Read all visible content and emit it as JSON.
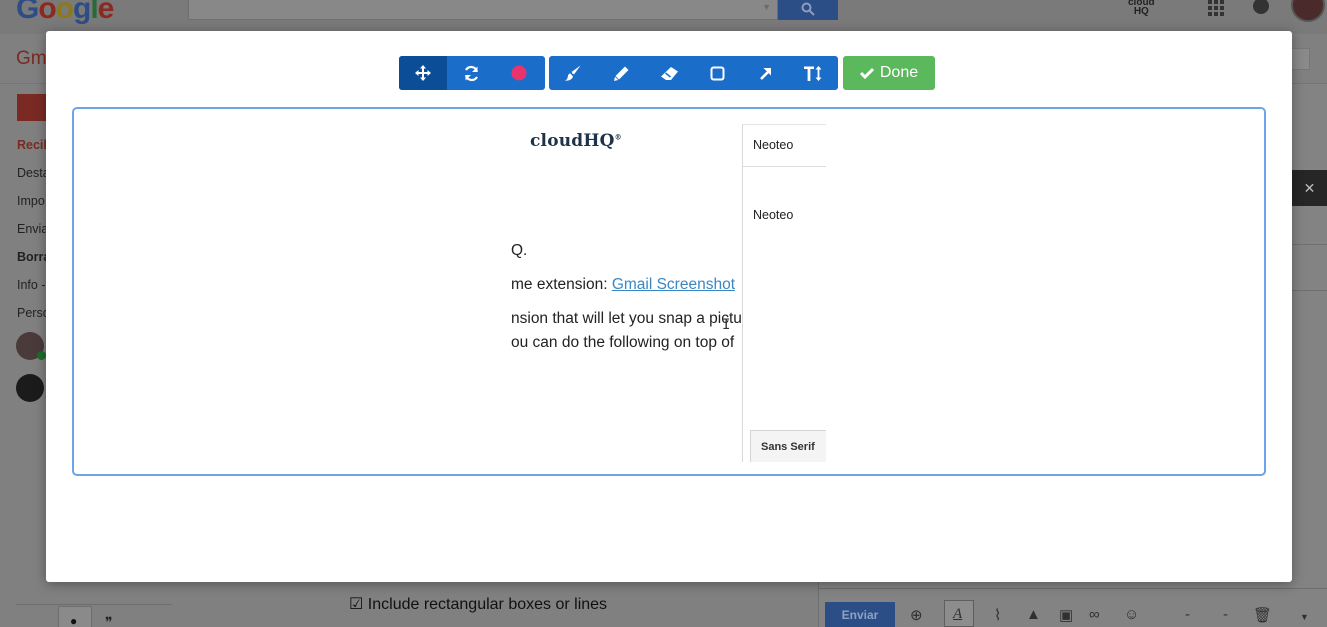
{
  "background": {
    "logo_text": "Google",
    "gmail_label": "Gm",
    "cloudhq_text_line1": "cloud",
    "cloudhq_text_line2": "HQ",
    "nav_items": [
      {
        "label": "Recil",
        "style": "active"
      },
      {
        "label": "Desta",
        "style": "normal"
      },
      {
        "label": "Impo",
        "style": "normal"
      },
      {
        "label": "Envia",
        "style": "normal"
      },
      {
        "label": "Borra",
        "style": "bold"
      },
      {
        "label": "Info -",
        "style": "normal"
      },
      {
        "label": "Perso",
        "style": "normal"
      }
    ],
    "include_boxes_label": "☑ Include rectangular boxes or lines",
    "send_button": "Enviar",
    "compose_close": "✕"
  },
  "toolbar": {
    "tools_group1": [
      {
        "name": "move-tool",
        "icon": "move-icon",
        "selected": true
      },
      {
        "name": "rotate-tool",
        "icon": "refresh-icon",
        "selected": false
      },
      {
        "name": "color-picker",
        "icon": "color-dot-icon",
        "selected": false,
        "color": "#e8336d"
      }
    ],
    "tools_group2": [
      {
        "name": "brush-tool",
        "icon": "brush-icon"
      },
      {
        "name": "pencil-tool",
        "icon": "pencil-icon"
      },
      {
        "name": "eraser-tool",
        "icon": "eraser-icon"
      },
      {
        "name": "rectangle-tool",
        "icon": "square-icon"
      },
      {
        "name": "arrow-tool",
        "icon": "arrow-icon"
      },
      {
        "name": "text-tool",
        "icon": "text-size-icon"
      }
    ],
    "done_label": "Done",
    "colors": {
      "toolbar": "#1a6dc8",
      "selected": "#0c4d97",
      "done": "#5cb85c",
      "canvas_border": "#6ca4ea"
    }
  },
  "canvas": {
    "logo": "cloudHQ",
    "logo_mark": "®",
    "line1": "Q.",
    "line2_prefix": "me extension: ",
    "line2_link": "Gmail Screenshot",
    "line3": "nsion that will let you snap a pictu",
    "line4": "ou can do the following on top of",
    "side_panel": {
      "row1": "Neoteo",
      "row2": "Neoteo",
      "font_select": "Sans Serif"
    }
  }
}
